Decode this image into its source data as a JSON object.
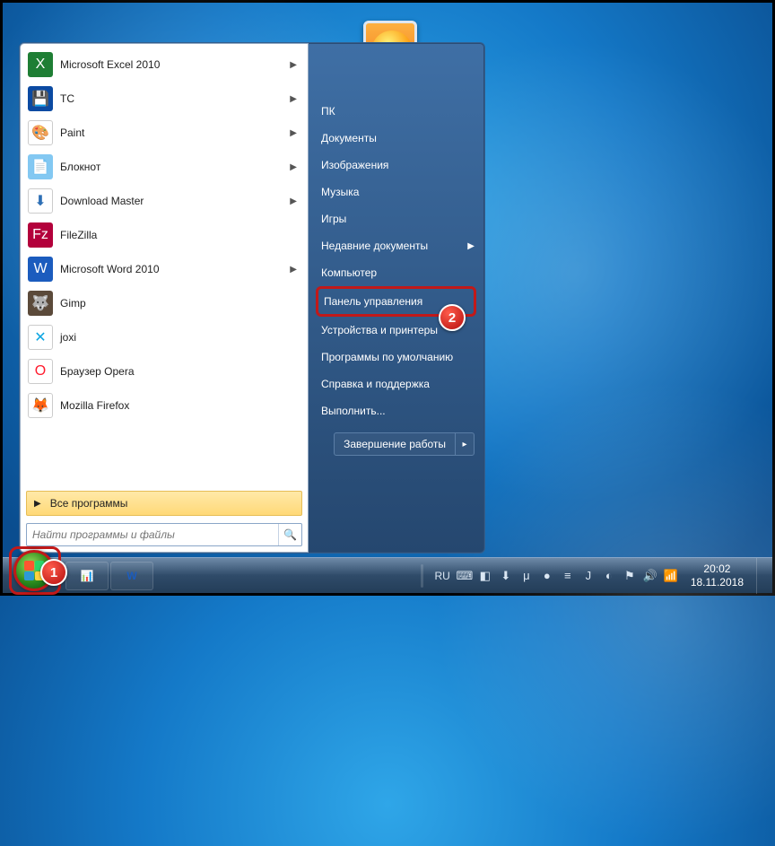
{
  "programs": [
    {
      "label": "Microsoft Excel 2010",
      "icon": "X",
      "cls": "i-excel",
      "arrow": true
    },
    {
      "label": "TC",
      "icon": "💾",
      "cls": "i-tc",
      "arrow": true
    },
    {
      "label": "Paint",
      "icon": "🎨",
      "cls": "i-paint",
      "arrow": true
    },
    {
      "label": "Блокнот",
      "icon": "📄",
      "cls": "i-note",
      "arrow": true
    },
    {
      "label": "Download Master",
      "icon": "⬇",
      "cls": "i-dm",
      "arrow": true
    },
    {
      "label": "FileZilla",
      "icon": "Fz",
      "cls": "i-fz",
      "arrow": false
    },
    {
      "label": "Microsoft Word 2010",
      "icon": "W",
      "cls": "i-word",
      "arrow": true
    },
    {
      "label": "Gimp",
      "icon": "🐺",
      "cls": "i-gimp",
      "arrow": false
    },
    {
      "label": "joxi",
      "icon": "✕",
      "cls": "i-joxi",
      "arrow": false
    },
    {
      "label": "Браузер Opera",
      "icon": "O",
      "cls": "i-opera",
      "arrow": false
    },
    {
      "label": "Mozilla Firefox",
      "icon": "🦊",
      "cls": "i-ff",
      "arrow": false
    }
  ],
  "all_programs_label": "Все программы",
  "search_placeholder": "Найти программы и файлы",
  "right_items": [
    {
      "label": "ПК",
      "arrow": false,
      "highlight": false
    },
    {
      "label": "Документы",
      "arrow": false,
      "highlight": false
    },
    {
      "label": "Изображения",
      "arrow": false,
      "highlight": false
    },
    {
      "label": "Музыка",
      "arrow": false,
      "highlight": false
    },
    {
      "label": "Игры",
      "arrow": false,
      "highlight": false
    },
    {
      "label": "Недавние документы",
      "arrow": true,
      "highlight": false
    },
    {
      "label": "Компьютер",
      "arrow": false,
      "highlight": false
    },
    {
      "label": "Панель управления",
      "arrow": false,
      "highlight": true
    },
    {
      "label": "Устройства и принтеры",
      "arrow": false,
      "highlight": false
    },
    {
      "label": "Программы по умолчанию",
      "arrow": false,
      "highlight": false
    },
    {
      "label": "Справка и поддержка",
      "arrow": false,
      "highlight": false
    },
    {
      "label": "Выполнить...",
      "arrow": false,
      "highlight": false
    }
  ],
  "shutdown_label": "Завершение работы",
  "badges": {
    "one": "1",
    "two": "2"
  },
  "taskbar": {
    "lang": "RU"
  },
  "tray_icons": [
    "⌨",
    "◧",
    "⬇",
    "μ",
    "●",
    "≡",
    "J",
    "◐",
    "⚑",
    "🔊",
    "📶"
  ],
  "clock": {
    "time": "20:02",
    "date": "18.11.2018"
  }
}
